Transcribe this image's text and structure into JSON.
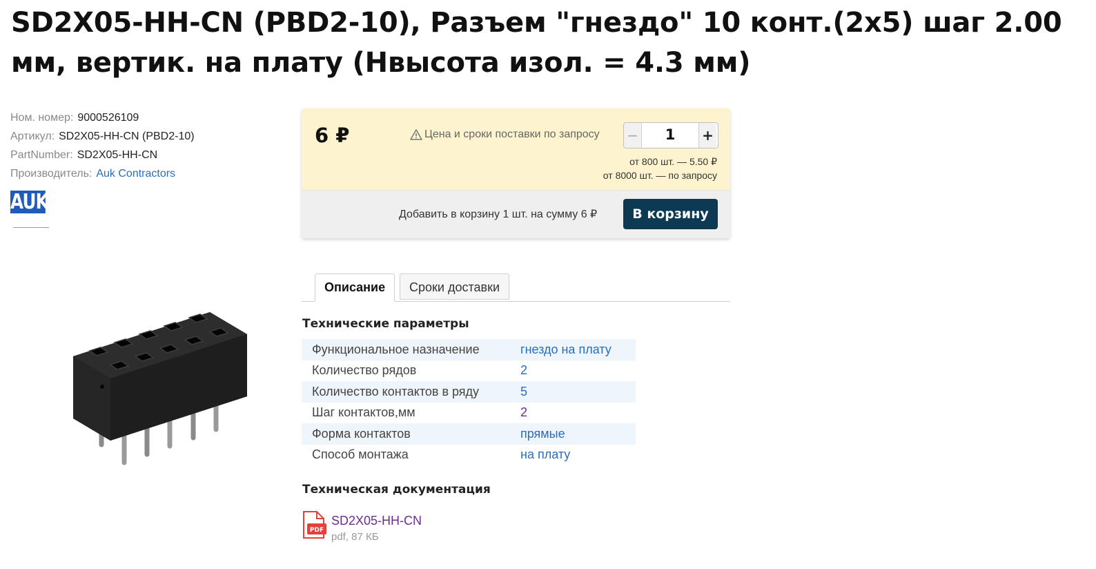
{
  "product": {
    "title": "SD2X05-HH-CN (PBD2-10), Разъем \"гнездо\" 10 конт.(2x5) шаг 2.00 мм, вертик. на плату (Нвысота изол. = 4.3 мм)"
  },
  "meta": {
    "nom_label": "Ном. номер:",
    "nom_value": "9000526109",
    "article_label": "Артикул:",
    "article_value": "SD2X05-HH-CN (PBD2-10)",
    "partnumber_label": "PartNumber:",
    "partnumber_value": "SD2X05-HH-CN",
    "manufacturer_label": "Производитель:",
    "manufacturer_value": "Auk Contractors",
    "brand_logo_text": "AUK"
  },
  "buybox": {
    "price": "6 ₽",
    "notice": "Цена и сроки поставки по запросу",
    "quantity": "1",
    "minus": "−",
    "plus": "+",
    "tiers": [
      "от 800 шт. — 5.50 ₽",
      "от 8000 шт. — по запросу"
    ],
    "summary": "Добавить в корзину 1 шт. на сумму 6 ₽",
    "cart_button": "В корзину",
    "colors": {
      "top_bg": "#fdf3cf",
      "bottom_bg": "#efefef",
      "button": "#0c3a55"
    }
  },
  "tabs": [
    {
      "label": "Описание",
      "active": true
    },
    {
      "label": "Сроки доставки",
      "active": false
    }
  ],
  "tech": {
    "title": "Технические параметры",
    "params": [
      {
        "key": "Функциональное назначение",
        "value": "гнездо на плату"
      },
      {
        "key": "Количество рядов",
        "value": "2"
      },
      {
        "key": "Количество контактов в ряду",
        "value": "5"
      },
      {
        "key": "Шаг контактов,мм",
        "value": "2"
      },
      {
        "key": "Форма контактов",
        "value": "прямые"
      },
      {
        "key": "Способ монтажа",
        "value": "на плату"
      }
    ]
  },
  "docs": {
    "title": "Техническая документация",
    "icon_text": "PDF",
    "file_name": "SD2X05-HH-CN",
    "file_meta": "pdf, 87 КБ"
  },
  "icons": {
    "warning": "warning-triangle-icon",
    "pdf": "pdf-file-icon"
  }
}
